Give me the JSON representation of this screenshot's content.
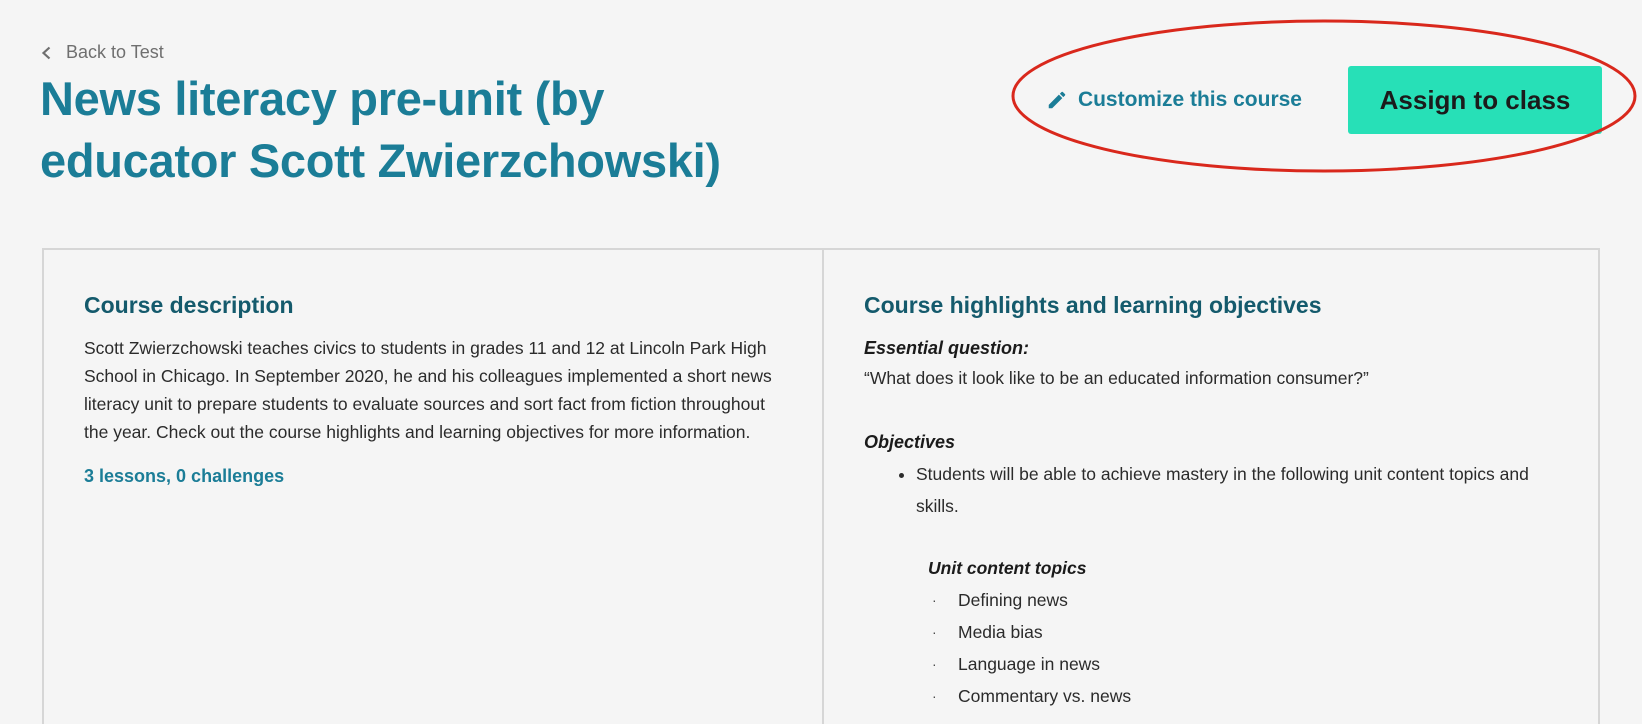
{
  "nav": {
    "back_label": "Back to Test",
    "back_icon": "chevron-left-icon"
  },
  "course": {
    "title": "News literacy pre-unit (by educator Scott Zwierzchowski)",
    "customize_label": "Customize this course",
    "customize_icon": "pencil-icon",
    "assign_label": "Assign to class"
  },
  "description": {
    "heading": "Course description",
    "body": "Scott Zwierzchowski teaches civics to students in grades 11 and 12 at Lincoln Park High School in Chicago. In September 2020, he and his colleagues implemented a short news literacy unit to prepare students to evaluate sources and sort fact from fiction throughout the year. Check out the course highlights and learning objectives for more information.",
    "meta": "3 lessons, 0 challenges"
  },
  "highlights": {
    "heading": "Course highlights and learning objectives",
    "essential_question_label": "Essential question:",
    "essential_question": "“What does it look like to be an educated information consumer?”",
    "objectives_label": "Objectives",
    "objectives": [
      "Students will be able to achieve mastery in the following unit content topics and skills."
    ],
    "topics_label": "Unit content topics",
    "topics": [
      "Defining news",
      "Media bias",
      "Language in news",
      "Commentary vs. news"
    ],
    "topic_bullet": "·"
  },
  "colors": {
    "brand": "#1b7d97",
    "heading_dark": "#145a6c",
    "assign_button": "#27e0b7",
    "annotation": "#d9281c",
    "background": "#f5f5f5"
  }
}
